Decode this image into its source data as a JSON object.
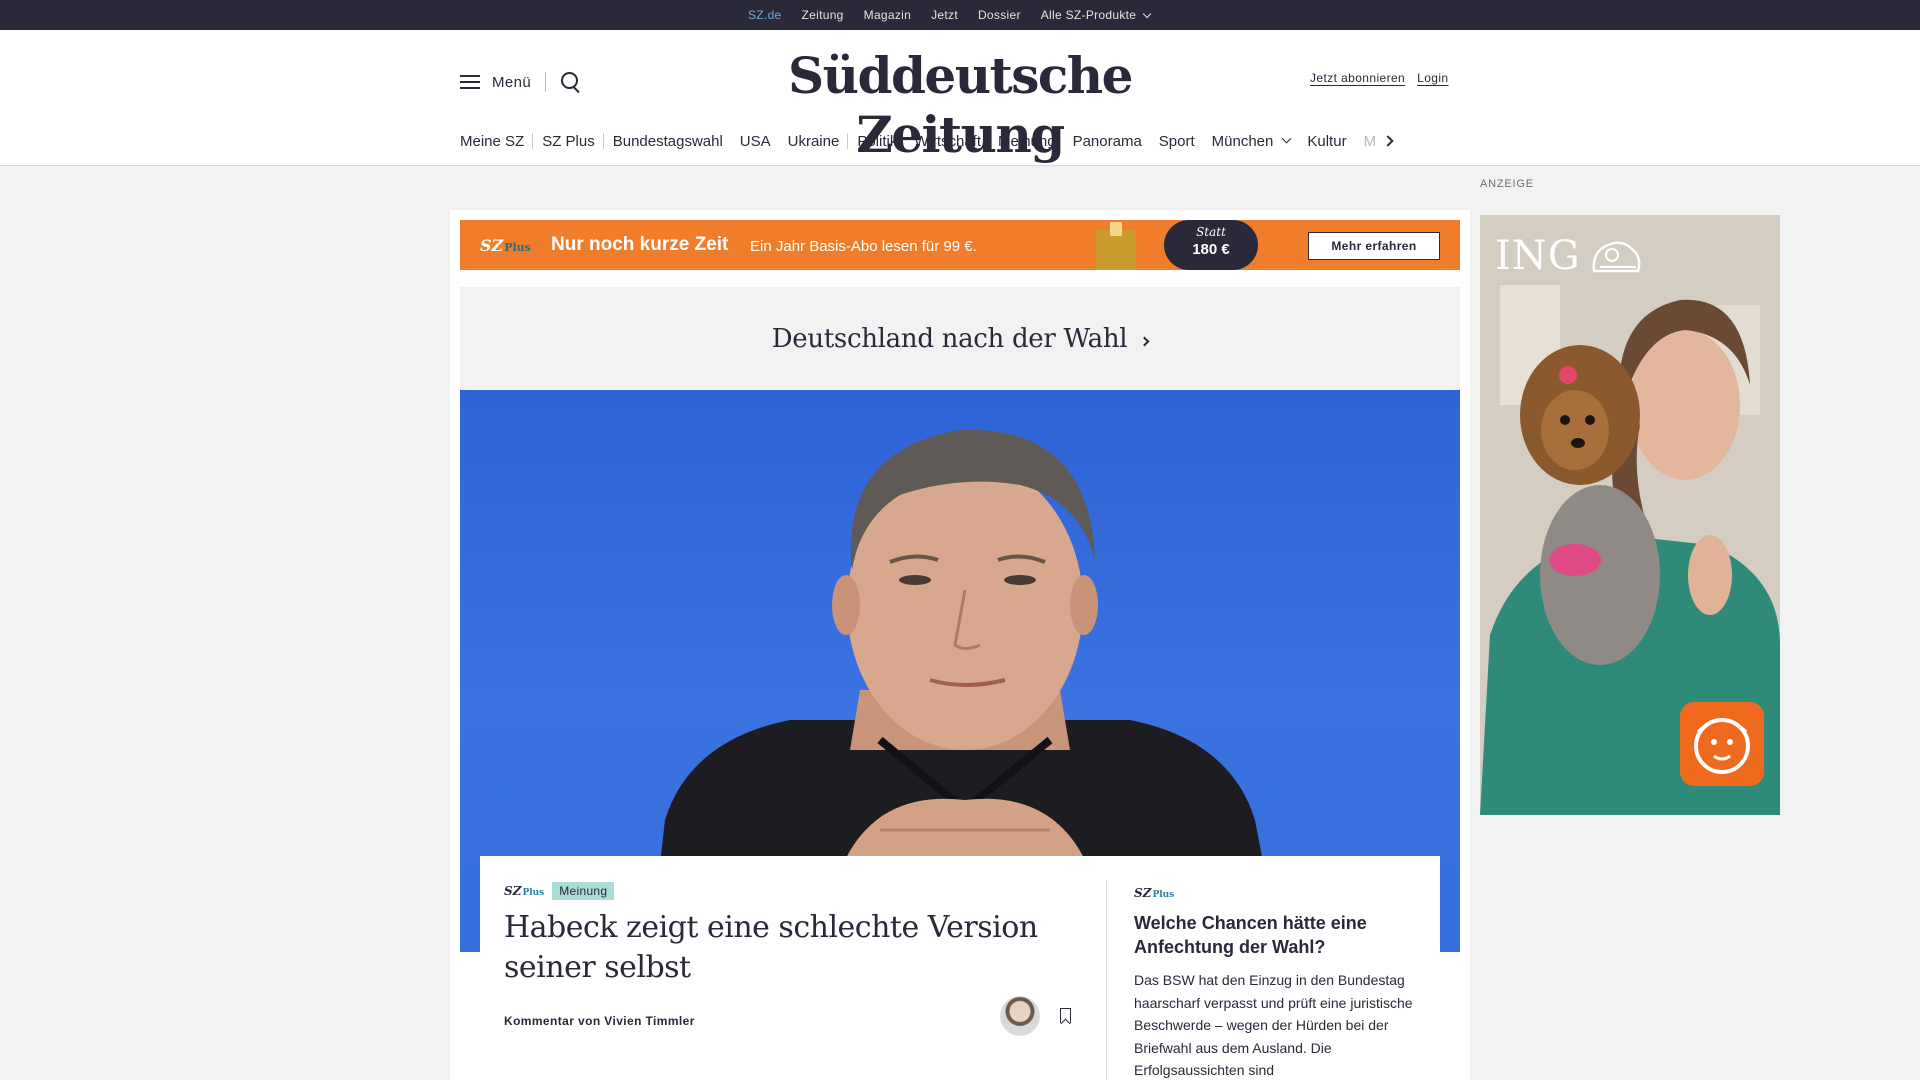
{
  "topbar": {
    "links": [
      "SZ.de",
      "Zeitung",
      "Magazin",
      "Jetzt",
      "Dossier"
    ],
    "products_label": "Alle SZ-Produkte"
  },
  "header": {
    "menu_label": "Menü",
    "logo": "Süddeutsche Zeitung",
    "subscribe_label": "Jetzt abonnieren",
    "login_label": "Login"
  },
  "nav": {
    "items": [
      "Meine SZ",
      "SZ Plus",
      "Bundestagswahl",
      "USA",
      "Ukraine",
      "Politik",
      "Wirtschaft",
      "Meinung",
      "Panorama",
      "Sport",
      "München",
      "Kultur",
      "M"
    ]
  },
  "promo": {
    "logo_main": "SZ",
    "logo_suffix": "Plus",
    "headline": "Nur noch kurze Zeit",
    "subline": "Ein Jahr Basis-Abo lesen für 99 €.",
    "price_prefix": "Statt",
    "price": "180 €",
    "cta": "Mehr erfahren",
    "color": "#ef7d2b"
  },
  "section": {
    "title": "Deutschland nach der Wahl"
  },
  "lead_article": {
    "logo_main": "SZ",
    "logo_suffix": "Plus",
    "tag": "Meinung",
    "title": "Habeck zeigt eine schlechte Version seiner selbst",
    "byline": "Kommentar von Vivien Timmler"
  },
  "side_article": {
    "logo_main": "SZ",
    "logo_suffix": "Plus",
    "title": "Welche Chancen hätte eine Anfechtung der Wahl?",
    "teaser": "Das BSW hat den Einzug in den Bundestag haarscharf verpasst und prüft eine juristische Beschwerde – wegen der Hürden bei der Briefwahl aus dem Ausland. Die Erfolgsaussichten sind"
  },
  "ad": {
    "label": "ANZEIGE",
    "brand": "ING",
    "brand_color": "#ef6a1f"
  },
  "colors": {
    "dark": "#29293a",
    "accent_link": "#6fa8dc",
    "meinung_badge": "#a9ddd6"
  }
}
